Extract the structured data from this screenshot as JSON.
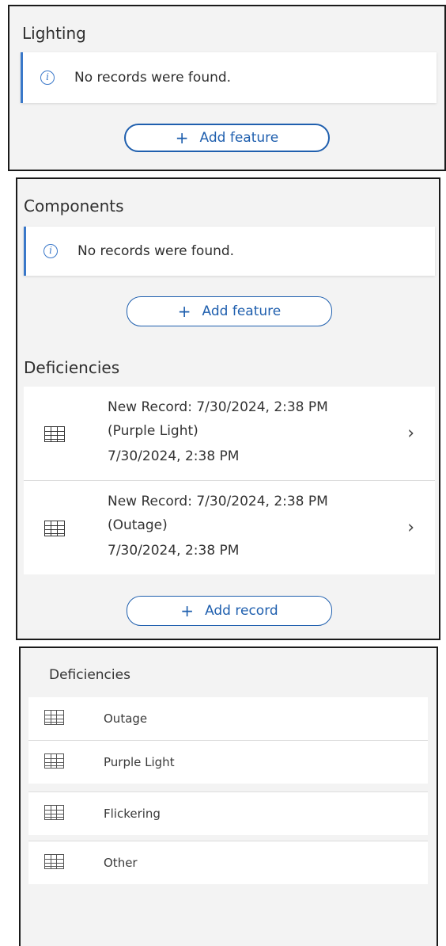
{
  "lighting": {
    "title": "Lighting",
    "notice": "No records were found.",
    "add_button": "Add feature"
  },
  "components": {
    "title": "Components",
    "notice": "No records were found.",
    "add_button": "Add feature"
  },
  "deficiencies": {
    "title": "Deficiencies",
    "records": [
      {
        "line1": "New Record: 7/30/2024, 2:38 PM",
        "line2": "(Purple Light)",
        "line3": "7/30/2024, 2:38 PM"
      },
      {
        "line1": "New Record: 7/30/2024, 2:38 PM",
        "line2": "(Outage)",
        "line3": "7/30/2024, 2:38 PM"
      }
    ],
    "add_button": "Add record"
  },
  "deficiency_types": {
    "title": "Deficiencies",
    "items": [
      "Outage",
      "Purple Light",
      "Flickering",
      "Other"
    ]
  },
  "icons": {
    "info": "info-icon",
    "plus": "plus-icon",
    "table": "table-icon",
    "chevron": "chevron-right-icon"
  },
  "colors": {
    "accent": "#1f5fae",
    "notice_border": "#3a78c9",
    "panel_bg": "#f3f3f3"
  }
}
